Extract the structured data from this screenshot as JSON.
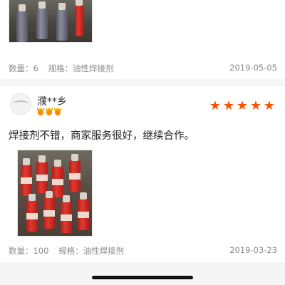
{
  "reviews": [
    {
      "quantity_label": "数量：",
      "quantity_value": "6",
      "spec_label": "规格：",
      "spec_value": "油性焊接剂",
      "date": "2019-05-05"
    },
    {
      "username": "濮**乡",
      "rating": 5,
      "text": "焊接剂不错，商家服务很好，继续合作。",
      "quantity_label": "数量：",
      "quantity_value": "100",
      "spec_label": "规格：",
      "spec_value": "油性焊接剂",
      "date": "2019-03-23"
    }
  ],
  "colors": {
    "star": "#ff5000",
    "meta_text": "#8a8a8a",
    "badge_crown": "#f4b400",
    "badge_gem": "#ff8a00"
  },
  "icons": {
    "star": "star-icon",
    "badge": "vip-crown-badge-icon"
  }
}
